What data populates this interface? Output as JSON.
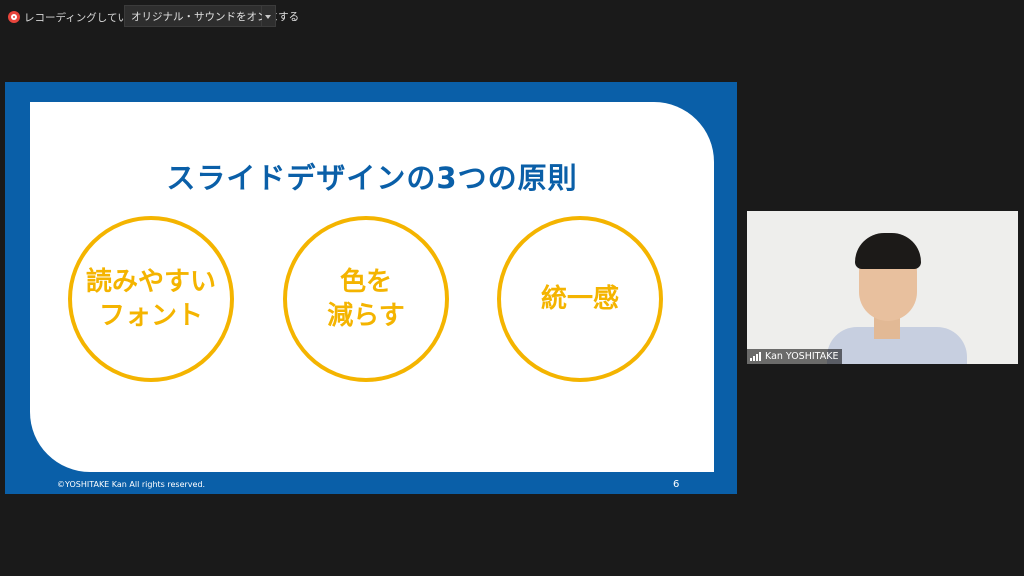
{
  "topbar": {
    "recording_text": "レコーディングしています",
    "original_sound_label": "オリジナル・サウンドをオンにする"
  },
  "slide": {
    "title": "スライドデザインの3つの原則",
    "principles": [
      "読みやすい\nフォント",
      "色を\n減らす",
      "統一感"
    ],
    "footer": "©YOSHITAKE Kan  All rights reserved.",
    "page_number": "6",
    "colors": {
      "blue": "#0a5fa8",
      "yellow": "#f4b400"
    }
  },
  "video": {
    "participant_name": "Kan YOSHITAKE"
  },
  "icons": {
    "recording": "recording-icon",
    "dropdown": "chevron-down-icon",
    "signal": "signal-bars-icon"
  }
}
